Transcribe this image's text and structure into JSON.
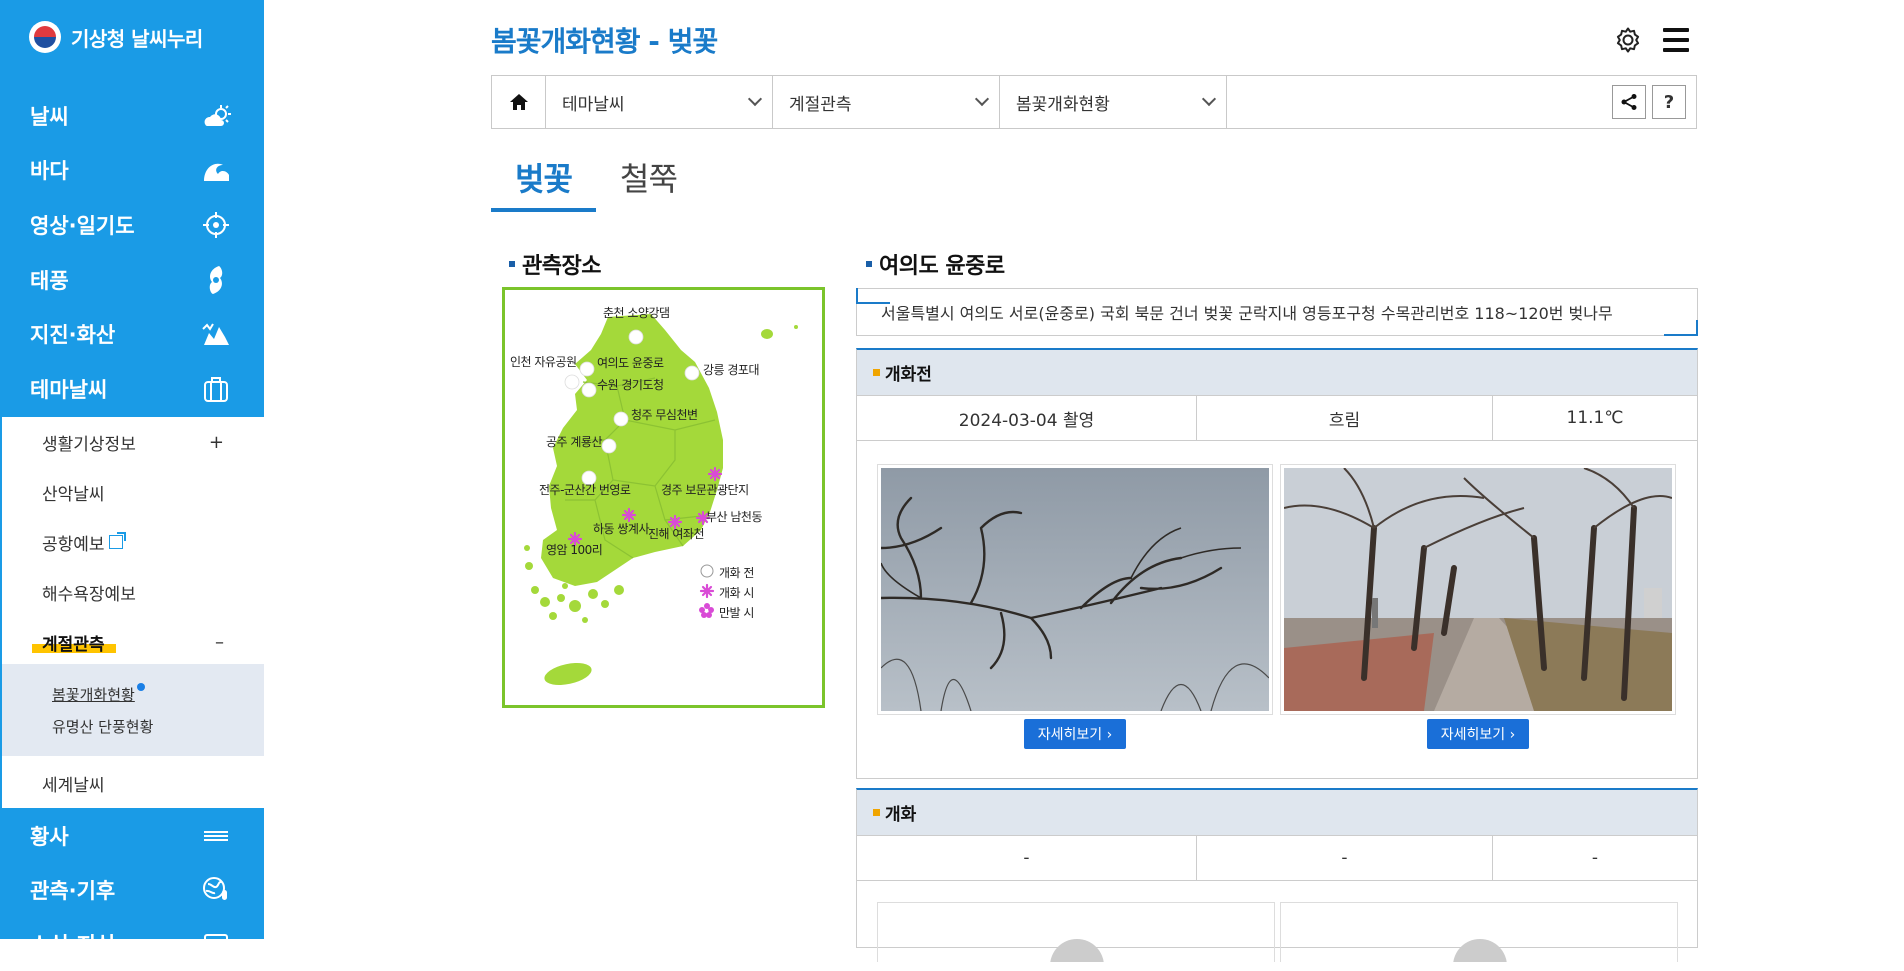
{
  "sidebar": {
    "logo_text": "기상청 날씨누리",
    "menu": [
      {
        "label": "날씨",
        "icon": "cloud-sun-icon"
      },
      {
        "label": "바다",
        "icon": "wave-icon"
      },
      {
        "label": "영상·일기도",
        "icon": "satellite-icon"
      },
      {
        "label": "태풍",
        "icon": "typhoon-icon"
      },
      {
        "label": "지진·화산",
        "icon": "earthquake-icon"
      },
      {
        "label": "테마날씨",
        "icon": "briefcase-icon"
      },
      {
        "label": "황사",
        "icon": "dust-icon"
      },
      {
        "label": "관측·기후",
        "icon": "globe-thermometer-icon"
      },
      {
        "label": "소식·지식",
        "icon": "news-icon"
      }
    ],
    "submenu": {
      "items": [
        {
          "label": "생활기상정보",
          "toggle": "+"
        },
        {
          "label": "산악날씨"
        },
        {
          "label": "공항예보"
        },
        {
          "label": "해수욕장예보"
        },
        {
          "label": "계절관측",
          "toggle": "–"
        },
        {
          "label": "세계날씨"
        }
      ],
      "children": [
        {
          "label": "봄꽃개화현황"
        },
        {
          "label": "유명산 단풍현황"
        }
      ]
    }
  },
  "header": {
    "title": "봄꽃개화현황 - 벚꽃",
    "breadcrumb": [
      "테마날씨",
      "계절관측",
      "봄꽃개화현황"
    ],
    "help_label": "?"
  },
  "tabs": [
    {
      "label": "벚꽃",
      "active": true
    },
    {
      "label": "철쭉",
      "active": false
    }
  ],
  "map_section": {
    "title": "관측장소",
    "locations": [
      "춘천 소양강댐",
      "인천 자유공원",
      "여의도 윤중로",
      "수원 경기도청",
      "강릉 경포대",
      "청주 무심천변",
      "공주 계룡산",
      "전주-군산간 번영로",
      "경주 보문관광단지",
      "하동 쌍계사",
      "진해 여좌천",
      "부산 남천동",
      "영암 100리"
    ],
    "legend": [
      "개화 전",
      "개화 시",
      "만발 시"
    ],
    "colors": {
      "land": "#a4d93a",
      "border": "#7bc42b",
      "bloom": "#d94bd6"
    }
  },
  "detail": {
    "title": "여의도 윤중로",
    "description": "서울특별시 여의도 서로(윤중로) 국회 북문 건너 벚꽃 군락지내 영등포구청 수목관리번호 118~120번 벚나무",
    "before": {
      "heading": "개화전",
      "date": "2024-03-04 촬영",
      "weather": "흐림",
      "temp": "11.1℃",
      "more_label": "자세히보기"
    },
    "bloom": {
      "heading": "개화",
      "date": "-",
      "weather": "-",
      "temp": "-"
    }
  },
  "colors": {
    "primary": "#1a9be6",
    "accent": "#1a7bc9",
    "highlight": "#ffc400"
  }
}
